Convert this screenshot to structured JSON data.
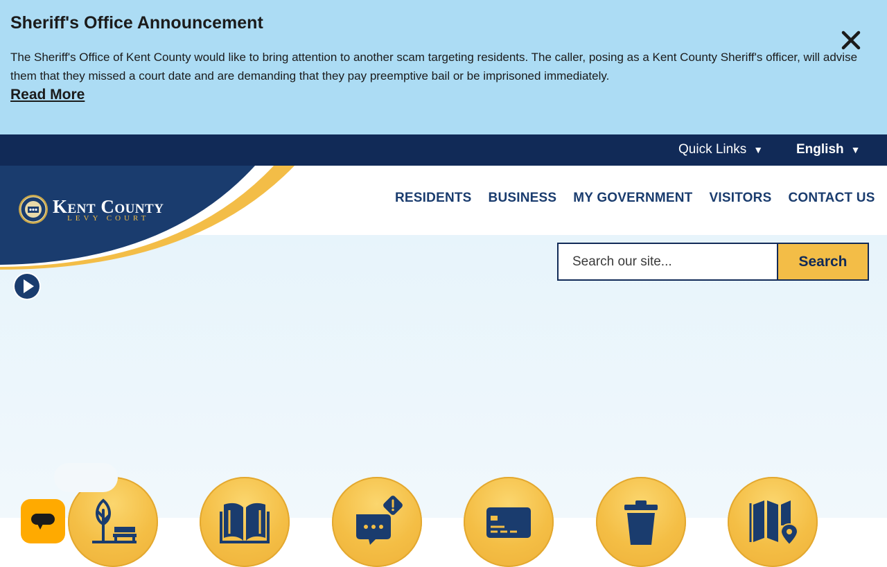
{
  "alert": {
    "title": "Sheriff's Office Announcement",
    "body": "The Sheriff's Office of Kent County would like to bring attention to another scam targeting residents. The caller, posing as a Kent County Sheriff's officer, will advise them that they missed a court date and are demanding that they pay preemptive bail or be imprisoned immediately.",
    "link": "Read More",
    "close_icon": "close-icon"
  },
  "utility": {
    "quick_links": "Quick Links",
    "language": "English",
    "caret": "▼"
  },
  "brand": {
    "name": "Kent County",
    "sub": "LEVY COURT"
  },
  "nav": {
    "items": [
      "RESIDENTS",
      "BUSINESS",
      "MY GOVERNMENT",
      "VISITORS",
      "CONTACT US"
    ]
  },
  "search": {
    "placeholder": "Search our site...",
    "button": "Search"
  },
  "colors": {
    "alert_bg": "#acdcf4",
    "navy": "#112a57",
    "logo_navy": "#1a3c6e",
    "gold": "#f3bd47",
    "chat": "#ffaa00"
  },
  "quick_icons": [
    "park-bench-icon",
    "book-icon",
    "chat-alert-icon",
    "credit-card-icon",
    "trash-can-icon",
    "map-pin-icon"
  ]
}
